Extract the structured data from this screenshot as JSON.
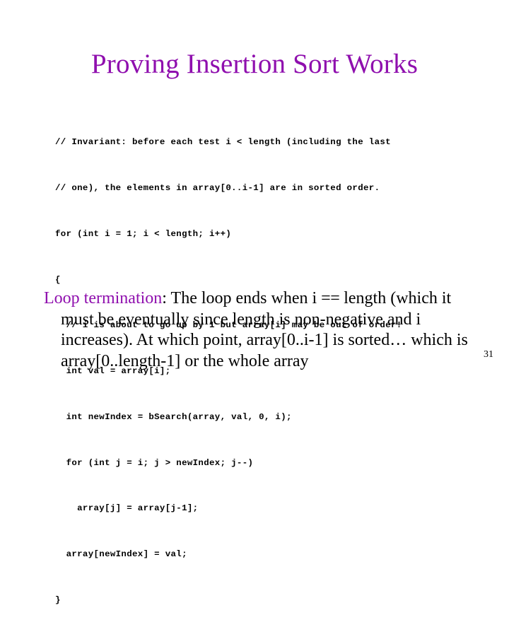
{
  "slide": {
    "title": "Proving Insertion Sort Works",
    "title_color": "#8f0fae",
    "background_color": "#ffffff",
    "page_number": "31"
  },
  "code": {
    "language": "java",
    "lines": [
      "// Invariant: before each test i < length (including the last",
      "// one), the elements in array[0..i-1] are in sorted order.",
      "for (int i = 1; i < length; i++)",
      "{",
      "  // i is about to go up by 1 but array[i] may be out of order!",
      "  int val = array[i];",
      "  int newIndex = bSearch(array, val, 0, i);",
      "  for (int j = i; j > newIndex; j--)",
      "    array[j] = array[j-1];",
      "  array[newIndex] = val;",
      "}"
    ]
  },
  "body": {
    "lead_in": "Loop termination",
    "lead_in_color": "#8f0fae",
    "text_part_1": ": The loop ends when i ",
    "equality_symbol": "==",
    "text_part_2": " length (which it must be eventually since length is non-negative and i increases).  At which point, array[0..i-1] is sorted… which is array[0..length-1] or the whole array"
  }
}
